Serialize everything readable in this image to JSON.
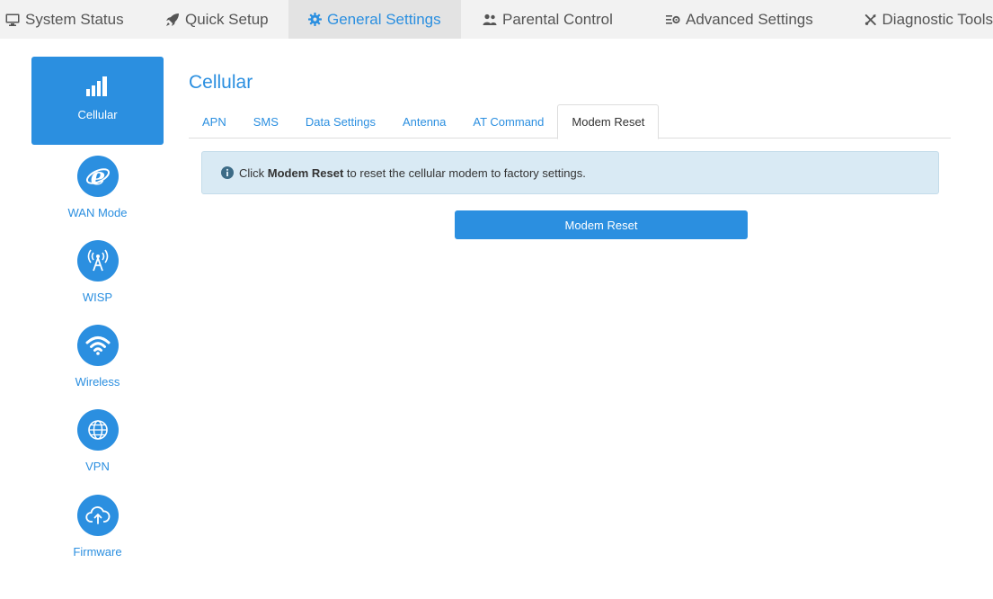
{
  "topnav": {
    "items": [
      {
        "label": "System Status",
        "icon": "monitor-icon"
      },
      {
        "label": "Quick Setup",
        "icon": "rocket-icon"
      },
      {
        "label": "General Settings",
        "icon": "gear-icon",
        "active": true
      },
      {
        "label": "Parental Control",
        "icon": "users-icon"
      },
      {
        "label": "Advanced Settings",
        "icon": "list-gear-icon"
      },
      {
        "label": "Diagnostic Tools",
        "icon": "tools-icon"
      }
    ]
  },
  "sidebar": {
    "items": [
      {
        "label": "Cellular",
        "icon": "signal-bars-icon",
        "active": true
      },
      {
        "label": "WAN Mode",
        "icon": "internet-e-icon"
      },
      {
        "label": "WISP",
        "icon": "antenna-icon"
      },
      {
        "label": "Wireless",
        "icon": "wifi-icon"
      },
      {
        "label": "VPN",
        "icon": "globe-icon"
      },
      {
        "label": "Firmware",
        "icon": "cloud-upload-icon"
      }
    ]
  },
  "main": {
    "title": "Cellular",
    "tabs": [
      {
        "label": "APN"
      },
      {
        "label": "SMS"
      },
      {
        "label": "Data Settings"
      },
      {
        "label": "Antenna"
      },
      {
        "label": "AT Command"
      },
      {
        "label": "Modem Reset",
        "active": true
      }
    ],
    "info": {
      "prefix": "Click ",
      "bold": "Modem Reset",
      "suffix": " to reset the cellular modem to factory settings."
    },
    "reset_button": "Modem Reset"
  },
  "colors": {
    "accent": "#2b8fe0",
    "nav_bg": "#f2f2f2",
    "info_bg": "#d9eaf4"
  }
}
